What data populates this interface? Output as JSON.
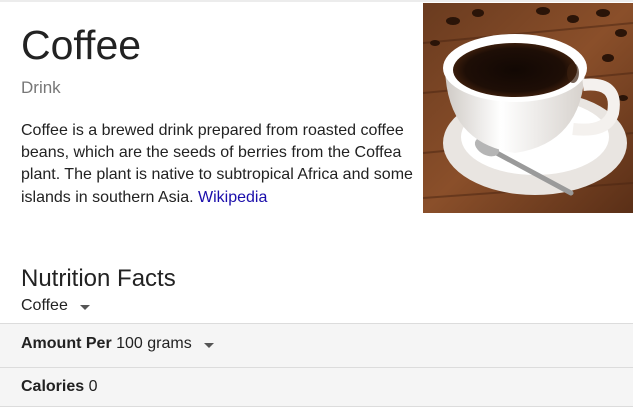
{
  "entity": {
    "title": "Coffee",
    "subtitle": "Drink",
    "description": "Coffee is a brewed drink prepared from roasted coffee beans, which are the seeds of berries from the Coffea plant. The plant is native to subtropical Africa and some islands in southern Asia.",
    "source_link": "Wikipedia"
  },
  "nutrition": {
    "title": "Nutrition Facts",
    "food_selected": "Coffee",
    "amount_label": "Amount Per",
    "amount_value": "100 grams",
    "calories_label": "Calories",
    "calories_value": "0"
  },
  "colors": {
    "link": "#1a0dab",
    "subtitle": "#777777",
    "row_background": "#f5f5f5"
  },
  "icons": {
    "dropdown": "caret-down-icon",
    "image": "coffee-cup-photo"
  }
}
